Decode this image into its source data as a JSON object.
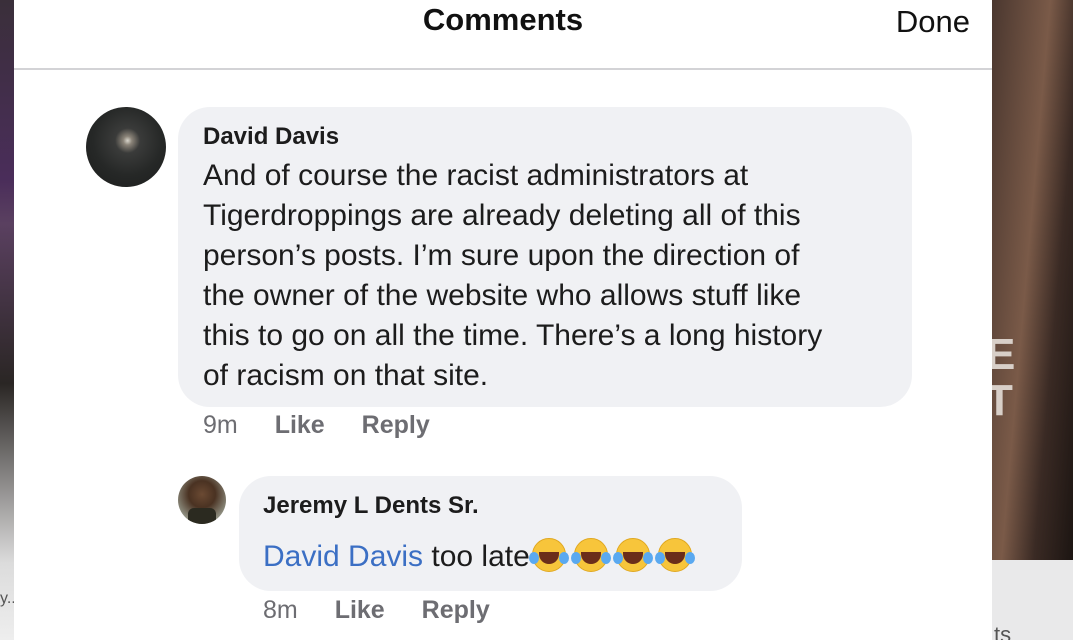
{
  "header": {
    "title": "Comments",
    "done_label": "Done"
  },
  "background": {
    "right_letters": "E\nT",
    "right_footer_text": "ts",
    "left_fragment": "y.."
  },
  "comments": [
    {
      "author": "David Davis",
      "text": "And of course the racist administrators at\nTigerdroppings are already deleting all of this\nperson’s posts.  I’m sure upon the direction of\nthe owner of the website who allows stuff like\nthis to go on all the time.  There’s a long history\nof racism on that site.",
      "time": "9m",
      "like_label": "Like",
      "reply_label": "Reply"
    },
    {
      "author": "Jeremy L Dents Sr.",
      "mention": "David Davis",
      "text": " too late",
      "emoji_name": "face-with-tears-of-joy-icon",
      "emoji_count": 4,
      "time": "8m",
      "like_label": "Like",
      "reply_label": "Reply"
    }
  ]
}
